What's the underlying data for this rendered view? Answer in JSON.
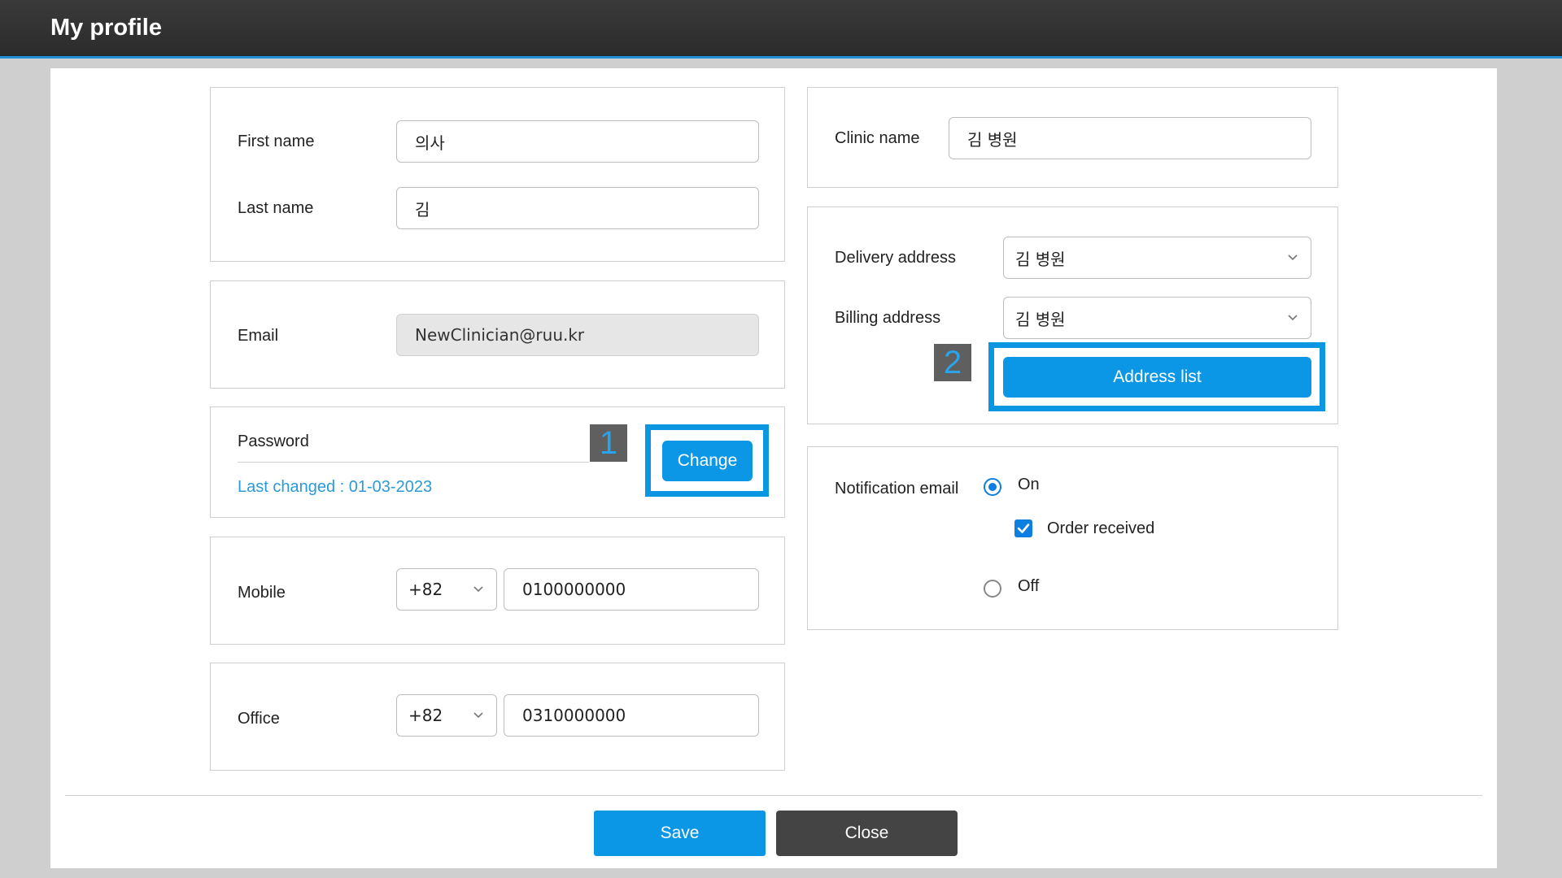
{
  "window": {
    "title": "My profile"
  },
  "name_card": {
    "first_name_label": "First name",
    "first_name_value": "의사",
    "last_name_label": "Last name",
    "last_name_value": "김"
  },
  "email_card": {
    "email_label": "Email",
    "email_value": "NewClinician@ruu.kr"
  },
  "password_card": {
    "password_label": "Password",
    "last_changed": "Last changed : 01-03-2023",
    "change_button": "Change",
    "marker": "1"
  },
  "mobile_card": {
    "label": "Mobile",
    "country_code": "+82",
    "number": "0100000000"
  },
  "office_card": {
    "label": "Office",
    "country_code": "+82",
    "number": "0310000000"
  },
  "clinic_card": {
    "label": "Clinic name",
    "value": "김 병원"
  },
  "address_card": {
    "delivery_label": "Delivery address",
    "delivery_value": "김 병원",
    "billing_label": "Billing address",
    "billing_value": "김 병원",
    "address_list_button": "Address list",
    "marker": "2"
  },
  "notification_card": {
    "label": "Notification email",
    "on_label": "On",
    "on_selected": true,
    "order_received_label": "Order received",
    "order_received_checked": true,
    "off_label": "Off"
  },
  "footer": {
    "save_label": "Save",
    "close_label": "Close"
  },
  "colors": {
    "accent": "#0c97e6",
    "highlight": "#0a96e0",
    "titlebar": "#2b2b2b",
    "link_text": "#2a9ad8"
  }
}
